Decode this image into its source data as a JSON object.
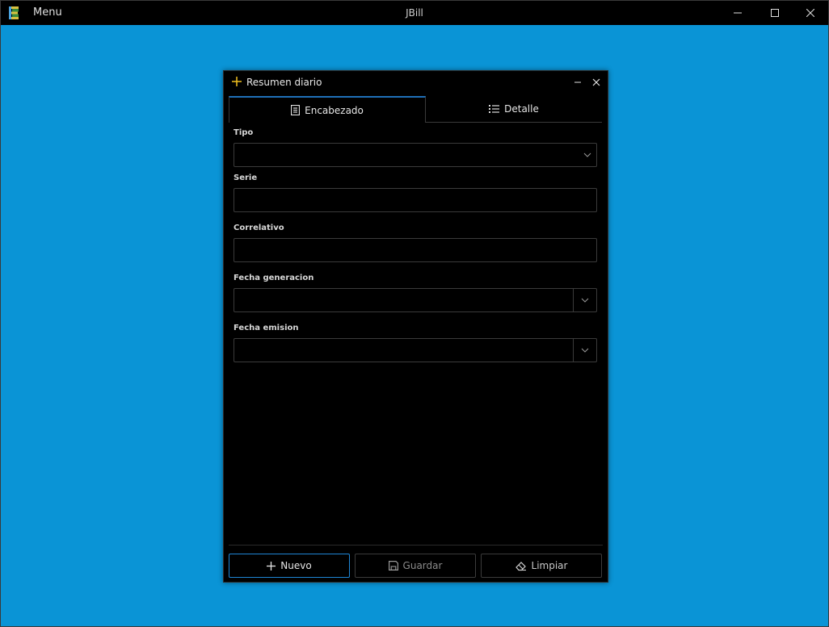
{
  "app": {
    "menu_label": "Menu",
    "title": "JBill"
  },
  "colors": {
    "desktop": "#0a94d6",
    "accent": "#1f86d6",
    "title_add_icon": "#f0c020"
  },
  "dialog": {
    "title": "Resumen diario",
    "tabs": [
      {
        "label": "Encabezado",
        "icon": "document-icon",
        "active": true
      },
      {
        "label": "Detalle",
        "icon": "list-icon",
        "active": false
      }
    ],
    "fields": {
      "tipo": {
        "label": "Tipo",
        "value": ""
      },
      "serie": {
        "label": "Serie",
        "value": ""
      },
      "correlativo": {
        "label": "Correlativo",
        "value": ""
      },
      "fecha_generacion": {
        "label": "Fecha generacion",
        "value": ""
      },
      "fecha_emision": {
        "label": "Fecha emision",
        "value": ""
      }
    },
    "buttons": {
      "nuevo": "Nuevo",
      "guardar": "Guardar",
      "limpiar": "Limpiar"
    }
  }
}
